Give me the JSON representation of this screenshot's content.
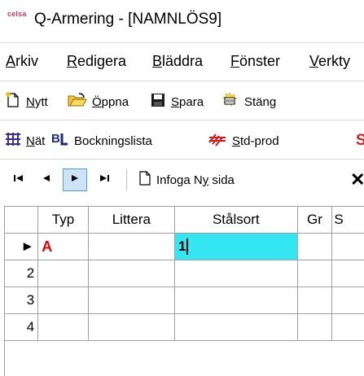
{
  "window": {
    "logo": "celsa",
    "title": "Q-Armering - [NAMNLÖS9]"
  },
  "menubar": {
    "items": [
      {
        "key": "A",
        "rest": "rkiv"
      },
      {
        "key": "R",
        "rest": "edigera"
      },
      {
        "key": "B",
        "rest": "läddra"
      },
      {
        "key": "F",
        "rest": "önster"
      },
      {
        "key": "V",
        "rest": "erkty"
      }
    ]
  },
  "toolbar_file": {
    "new": {
      "key": "N",
      "rest": "ytt"
    },
    "open": {
      "key": "Ö",
      "rest": "ppna"
    },
    "save": {
      "key": "S",
      "rest": "para"
    },
    "close": {
      "key": "",
      "rest": "Stäng"
    }
  },
  "toolbar_tools": {
    "net": {
      "key": "N",
      "rest": "ät"
    },
    "booking": {
      "label": "Bockningslista"
    },
    "std": {
      "key": "S",
      "rest": "td-prod"
    }
  },
  "toolbar_nav": {
    "insert_page": {
      "pre": "Infoga N",
      "key": "y",
      "rest": " sida"
    }
  },
  "grid": {
    "columns": [
      "Typ",
      "Littera",
      "Stålsort",
      "Gr",
      "S"
    ],
    "rows": [
      {
        "num": "",
        "marker": "►",
        "typ": "A",
        "littera": "",
        "stalsort": "1",
        "gr": ""
      },
      {
        "num": "2",
        "marker": "",
        "typ": "",
        "littera": "",
        "stalsort": "",
        "gr": ""
      },
      {
        "num": "3",
        "marker": "",
        "typ": "",
        "littera": "",
        "stalsort": "",
        "gr": ""
      },
      {
        "num": "4",
        "marker": "",
        "typ": "",
        "littera": "",
        "stalsort": "",
        "gr": ""
      }
    ]
  },
  "colors": {
    "accent_edit": "#33e6f2",
    "typ_red": "#e00000",
    "logo": "#c23b6a"
  }
}
